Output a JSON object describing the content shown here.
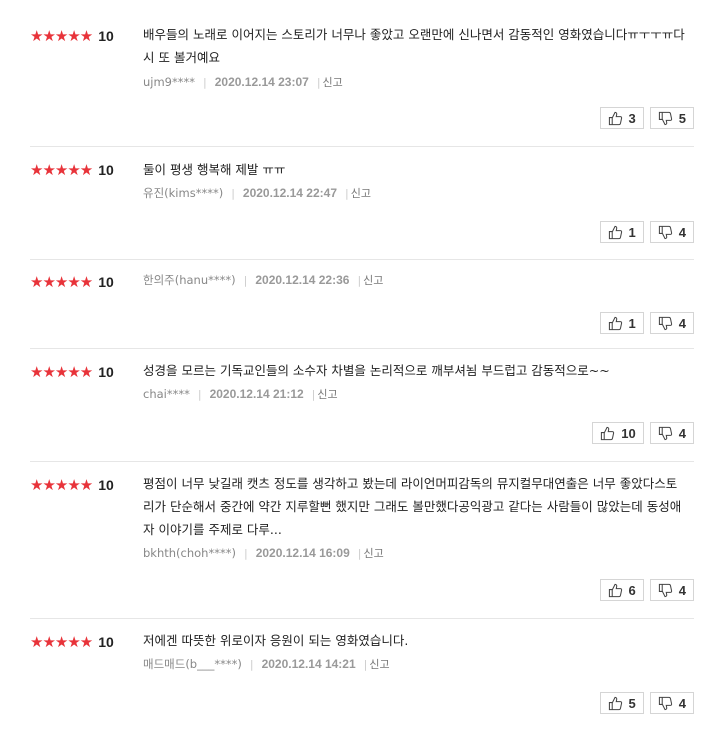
{
  "reviews": [
    {
      "stars": "★★★★★",
      "score": "10",
      "text": "배우들의 노래로 이어지는 스토리가 너무나 좋았고 오랜만에 신나면서 감동적인 영화였습니다ㅠㅜㅜㅠ다시 또 볼거예요",
      "user": "ujm9****",
      "date": "2020.12.14 23:07",
      "report": "신고",
      "likes": "3",
      "dislikes": "5"
    },
    {
      "stars": "★★★★★",
      "score": "10",
      "text": "둘이 평생 행복해 제발 ㅠㅠ",
      "user": "유진(kims****)",
      "date": "2020.12.14 22:47",
      "report": "신고",
      "likes": "1",
      "dislikes": "4"
    },
    {
      "stars": "★★★★★",
      "score": "10",
      "text": "",
      "user": "한의주(hanu****)",
      "date": "2020.12.14 22:36",
      "report": "신고",
      "likes": "1",
      "dislikes": "4"
    },
    {
      "stars": "★★★★★",
      "score": "10",
      "text": "성경을 모르는 기독교인들의 소수자 차별을 논리적으로 깨부셔뇜 부드럽고 감동적으로~~",
      "user": "chai****",
      "date": "2020.12.14 21:12",
      "report": "신고",
      "likes": "10",
      "dislikes": "4"
    },
    {
      "stars": "★★★★★",
      "score": "10",
      "text": "평점이 너무 낮길래 캣츠 정도를 생각하고 봤는데 라이언머피감독의 뮤지컬무대연출은 너무 좋았다스토리가 단순해서 중간에 약간 지루할뻔 했지만 그래도 볼만했다공익광고 같다는 사람들이 많았는데 동성애자 이야기를 주제로 다루...",
      "user": "bkhth(choh****)",
      "date": "2020.12.14 16:09",
      "report": "신고",
      "likes": "6",
      "dislikes": "4"
    },
    {
      "stars": "★★★★★",
      "score": "10",
      "text": "저에겐 따뜻한 위로이자 응원이 되는 영화였습니다.",
      "user": "매드매드(b___****)",
      "date": "2020.12.14 14:21",
      "report": "신고",
      "likes": "5",
      "dislikes": "4"
    }
  ]
}
